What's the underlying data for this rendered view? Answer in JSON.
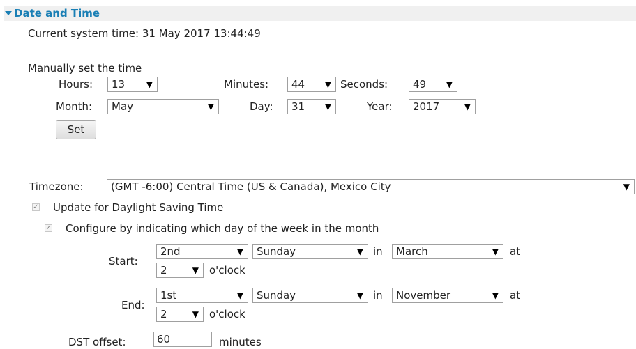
{
  "section": {
    "title": "Date and Time"
  },
  "current_time": "Current system time: 31 May 2017 13:44:49",
  "manual": {
    "heading": "Manually set the time",
    "hours_label": "Hours:",
    "hours_value": "13",
    "minutes_label": "Minutes:",
    "minutes_value": "44",
    "seconds_label": "Seconds:",
    "seconds_value": "49",
    "month_label": "Month:",
    "month_value": "May",
    "day_label": "Day:",
    "day_value": "31",
    "year_label": "Year:",
    "year_value": "2017",
    "set_button": "Set"
  },
  "timezone": {
    "label": "Timezone:",
    "value": "(GMT -6:00) Central Time (US & Canada), Mexico City"
  },
  "dst": {
    "update_label": "Update for Daylight Saving Time",
    "update_checked": true,
    "configure_label": "Configure by indicating which day of the week in the month",
    "configure_checked": true,
    "start": {
      "label": "Start:",
      "week": "2nd",
      "weekday": "Sunday",
      "in": "in",
      "month": "March",
      "at": "at",
      "hour": "2",
      "oclock": "o'clock"
    },
    "end": {
      "label": "End:",
      "week": "1st",
      "weekday": "Sunday",
      "in": "in",
      "month": "November",
      "at": "at",
      "hour": "2",
      "oclock": "o'clock"
    },
    "offset_label": "DST offset:",
    "offset_value": "60",
    "offset_unit": "minutes"
  },
  "icons": {
    "collapse": "triangle-down-icon",
    "dropdown": "dropdown-arrow-icon",
    "check": "checkbox-icon"
  },
  "colors": {
    "header_text": "#1a7fb5",
    "header_bg": "#f0f0f0"
  }
}
